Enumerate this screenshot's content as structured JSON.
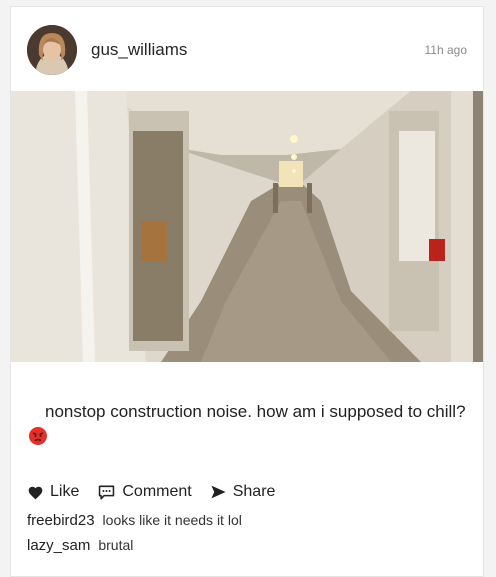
{
  "post": {
    "username": "gus_williams",
    "timestamp": "11h ago",
    "caption": "nonstop construction noise. how am i supposed to chill?"
  },
  "actions": {
    "like_label": "Like",
    "comment_label": "Comment",
    "share_label": "Share"
  },
  "comments": [
    {
      "user": "freebird23",
      "text": "looks like it needs it lol"
    },
    {
      "user": "lazy_sam",
      "text": "brutal"
    }
  ],
  "colors": {
    "emoji_red": "#e0322a",
    "card_bg": "#ffffff"
  },
  "icons": {
    "like": "heart-icon",
    "comment": "speech-bubble-icon",
    "share": "paper-plane-icon",
    "emoji": "angry-face-emoji"
  }
}
